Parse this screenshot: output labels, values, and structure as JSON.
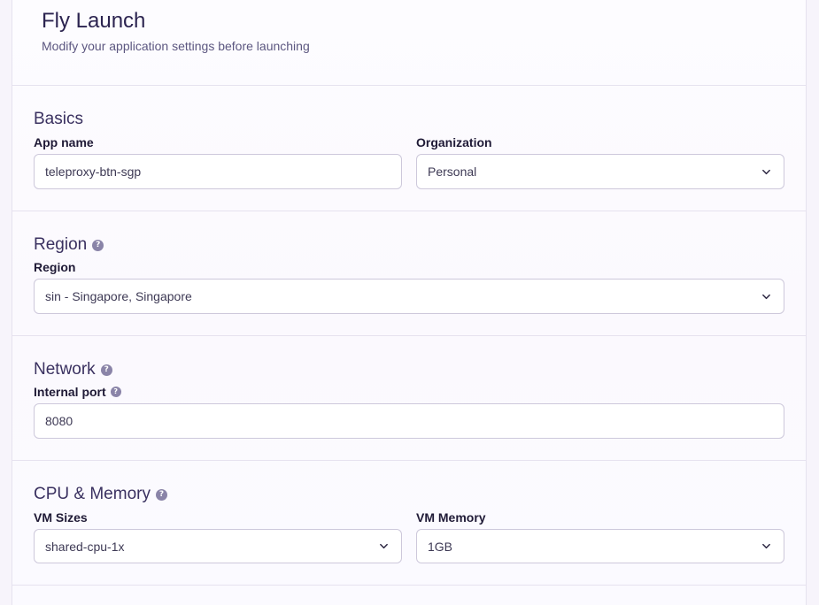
{
  "header": {
    "title": "Fly Launch",
    "subtitle": "Modify your application settings before launching"
  },
  "basics": {
    "title": "Basics",
    "app_name_label": "App name",
    "app_name_value": "teleproxy-btn-sgp",
    "organization_label": "Organization",
    "organization_value": "Personal"
  },
  "region": {
    "title": "Region",
    "region_label": "Region",
    "region_value": "sin - Singapore, Singapore"
  },
  "network": {
    "title": "Network",
    "internal_port_label": "Internal port",
    "internal_port_value": "8080"
  },
  "cpu_memory": {
    "title": "CPU & Memory",
    "vm_sizes_label": "VM Sizes",
    "vm_sizes_value": "shared-cpu-1x",
    "vm_memory_label": "VM Memory",
    "vm_memory_value": "1GB"
  },
  "icons": {
    "help": "?",
    "chevron": "chevron-down-icon"
  },
  "colors": {
    "text_primary": "#2c2450",
    "border": "#cdc8db",
    "help_icon_bg": "#8a84a8"
  }
}
